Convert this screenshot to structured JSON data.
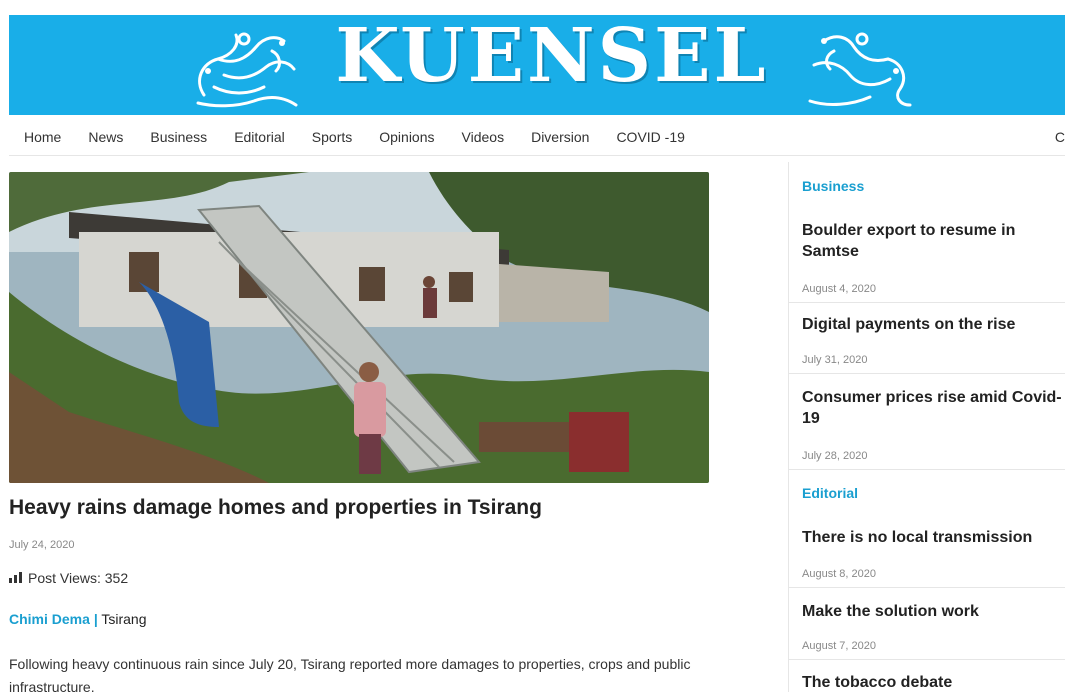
{
  "site": {
    "name": "KUENSEL",
    "brand_color": "#19aee8",
    "accent_color": "#1a9fd0"
  },
  "nav": {
    "items": [
      {
        "label": "Home"
      },
      {
        "label": "News"
      },
      {
        "label": "Business"
      },
      {
        "label": "Editorial"
      },
      {
        "label": "Sports"
      },
      {
        "label": "Opinions"
      },
      {
        "label": "Videos"
      },
      {
        "label": "Diversion"
      },
      {
        "label": "COVID -19"
      }
    ],
    "overflow_label": "C"
  },
  "article": {
    "title": "Heavy rains damage homes and properties in Tsirang",
    "date": "July 24, 2020",
    "views_icon": "bar-chart-icon",
    "views_label": "Post Views: 352",
    "author": "Chimi Dema",
    "separator": "|",
    "location": "Tsirang",
    "body": "Following heavy continuous rain since July 20, Tsirang reported more damages to properties, crops and public infrastructure."
  },
  "sidebar": {
    "business": {
      "heading": "Business",
      "items": [
        {
          "title": "Boulder export to resume in Samtse",
          "date": "August 4, 2020"
        },
        {
          "title": "Digital payments on the rise",
          "date": "July 31, 2020"
        },
        {
          "title": "Consumer prices rise amid Covid-19",
          "date": "July 28, 2020"
        }
      ]
    },
    "editorial": {
      "heading": "Editorial",
      "items": [
        {
          "title": "There is no local transmission",
          "date": "August 8, 2020"
        },
        {
          "title": "Make the solution work",
          "date": "August 7, 2020"
        },
        {
          "title": "The tobacco debate",
          "date": ""
        }
      ]
    }
  }
}
